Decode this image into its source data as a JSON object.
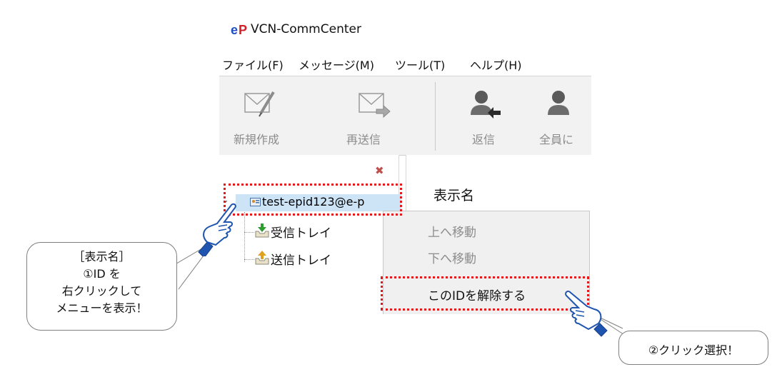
{
  "window": {
    "title": "VCN-CommCenter",
    "logo_text": "eP"
  },
  "menubar": {
    "items": [
      "ファイル(F)",
      "メッセージ(M)",
      "ツール(T)",
      "ヘルプ(H)"
    ]
  },
  "toolbar": {
    "new_label": "新規作成",
    "resend_label": "再送信",
    "reply_label": "返信",
    "reply_all_label": "全員に"
  },
  "folder_pane": {
    "close_icon": "close-icon",
    "account": "test-epid123@e-p",
    "folders": [
      "受信トレイ",
      "送信トレイ"
    ]
  },
  "list_pane": {
    "column_header": "表示名"
  },
  "context_menu": {
    "items": [
      {
        "label": "上へ移動",
        "enabled": false
      },
      {
        "label": "下へ移動",
        "enabled": false
      },
      {
        "label": "このIDを解除する",
        "enabled": true
      }
    ]
  },
  "annotations": {
    "callout1_lines": [
      "［表示名］",
      "①ID を",
      "右クリックして",
      "メニューを表示！"
    ],
    "callout2": "②クリック選択！",
    "highlight_color": "#e3191b"
  }
}
